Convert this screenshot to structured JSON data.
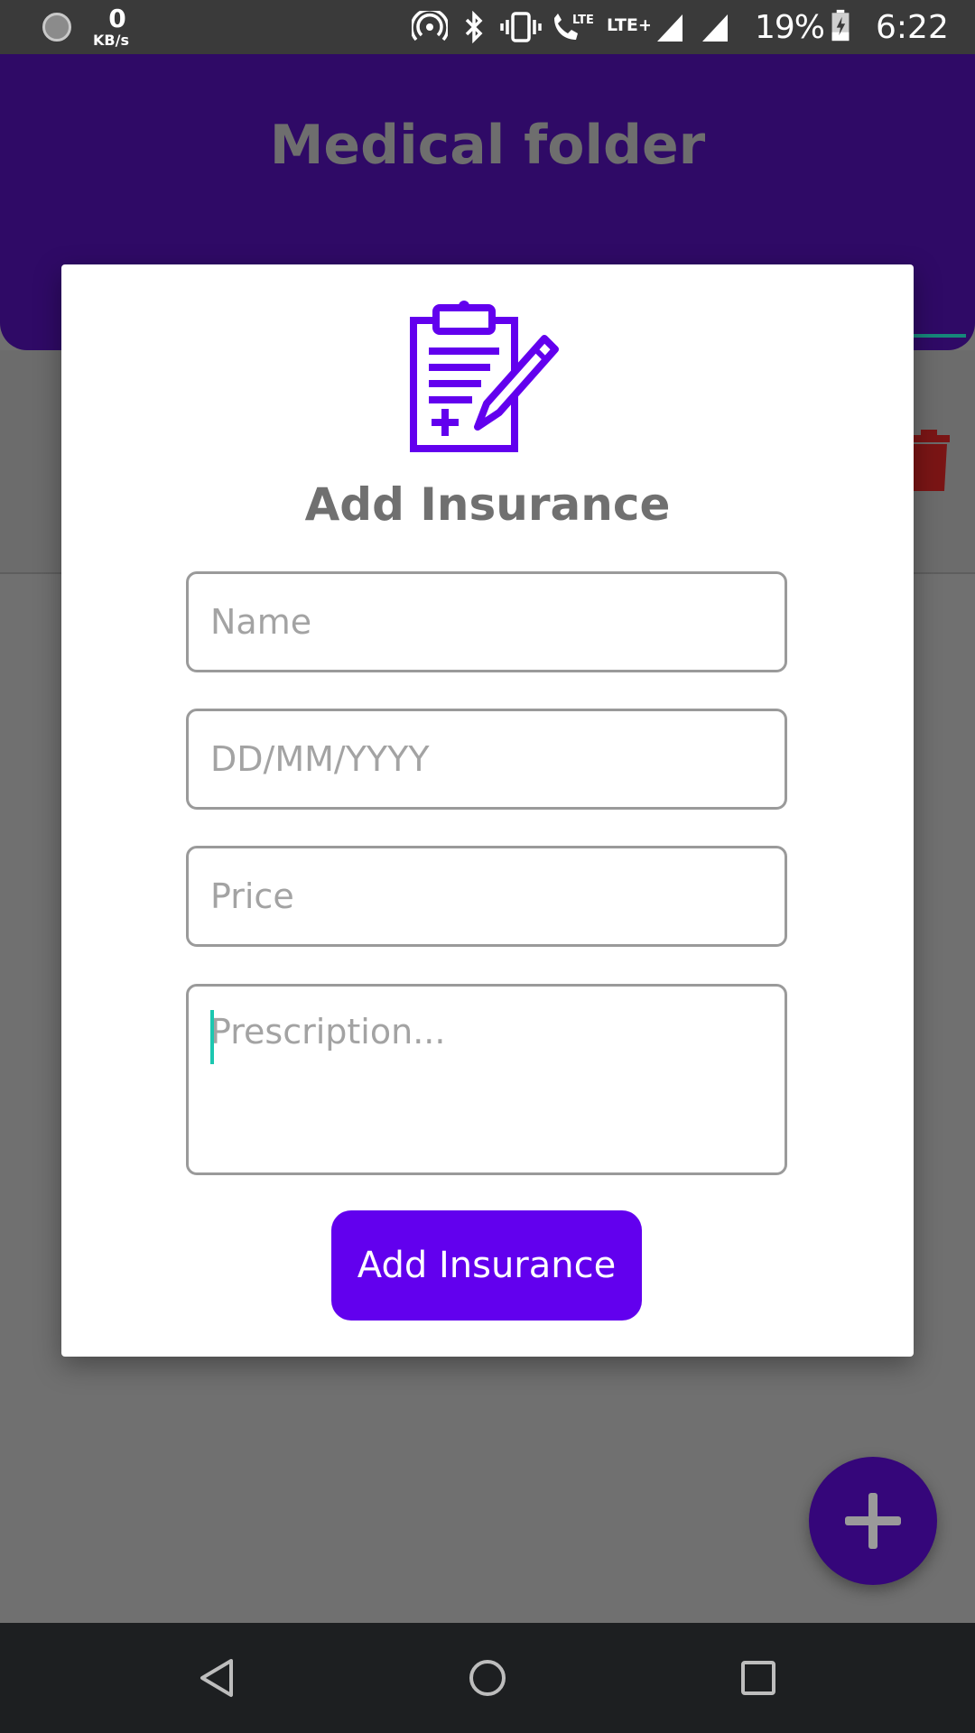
{
  "status_bar": {
    "network_speed": "0",
    "network_unit": "KB/s",
    "battery_percent": "19%",
    "time": "6:22",
    "icons": [
      "hotspot-icon",
      "bluetooth-icon",
      "vibrate-icon",
      "lte-call-icon",
      "lte-plus-icon",
      "signal-icon",
      "signal-icon",
      "battery-charging-icon"
    ]
  },
  "app": {
    "title": "Medical folder"
  },
  "dialog": {
    "title": "Add Insurance",
    "icon": "clipboard-pen-icon",
    "fields": {
      "name_placeholder": "Name",
      "date_placeholder": "DD/MM/YYYY",
      "price_placeholder": "Price",
      "prescription_placeholder": "Prescription..."
    },
    "submit_label": "Add Insurance"
  },
  "fab": {
    "icon": "plus-icon"
  },
  "nav": [
    "back-icon",
    "home-icon",
    "recents-icon"
  ],
  "colors": {
    "accent": "#6200ee",
    "header": "#2f0a66",
    "caret": "#1cc7b0"
  }
}
